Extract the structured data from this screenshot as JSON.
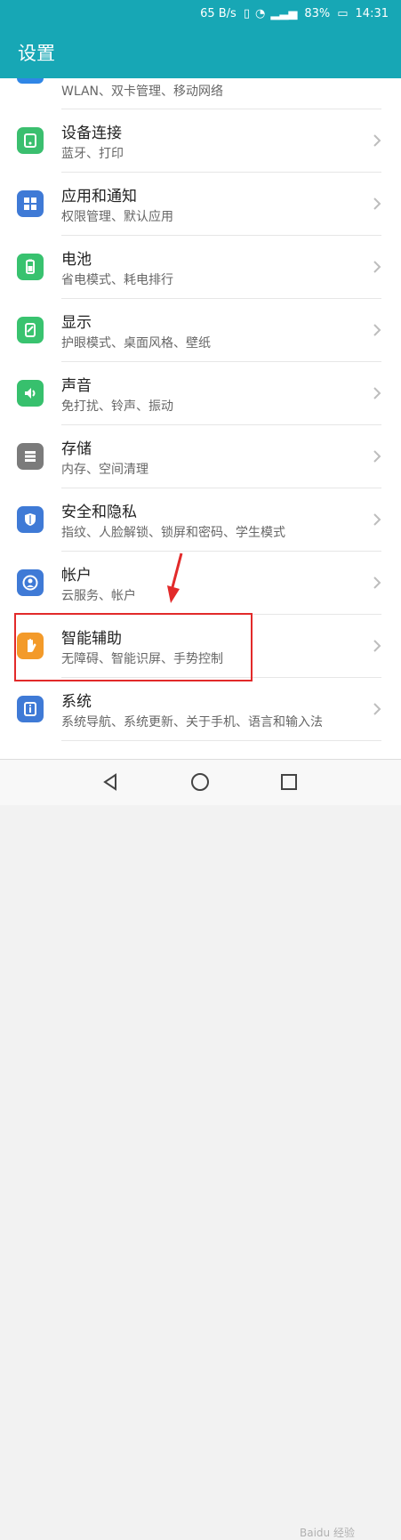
{
  "status": {
    "speed": "65 B/s",
    "battery": "83%",
    "time": "14:31"
  },
  "app": {
    "title": "设置"
  },
  "partial": {
    "subtitle": "WLAN、双卡管理、移动网络"
  },
  "items": [
    {
      "title": "设备连接",
      "subtitle": "蓝牙、打印",
      "icon": "device-connect-icon",
      "color": "#3bbf6f"
    },
    {
      "title": "应用和通知",
      "subtitle": "权限管理、默认应用",
      "icon": "apps-icon",
      "color": "#3f7ad6"
    },
    {
      "title": "电池",
      "subtitle": "省电模式、耗电排行",
      "icon": "battery-icon",
      "color": "#38c26f"
    },
    {
      "title": "显示",
      "subtitle": "护眼模式、桌面风格、壁纸",
      "icon": "display-icon",
      "color": "#39c36f"
    },
    {
      "title": "声音",
      "subtitle": "免打扰、铃声、振动",
      "icon": "speaker-icon",
      "color": "#37c06d"
    },
    {
      "title": "存储",
      "subtitle": "内存、空间清理",
      "icon": "storage-icon",
      "color": "#7b7b7b"
    },
    {
      "title": "安全和隐私",
      "subtitle": "指纹、人脸解锁、锁屏和密码、学生模式",
      "icon": "shield-icon",
      "color": "#3f7ad6"
    },
    {
      "title": "帐户",
      "subtitle": "云服务、帐户",
      "icon": "account-icon",
      "color": "#3f7ad6"
    },
    {
      "title": "智能辅助",
      "subtitle": "无障碍、智能识屏、手势控制",
      "icon": "hand-icon",
      "color": "#f39a2a"
    },
    {
      "title": "系统",
      "subtitle": "系统导航、系统更新、关于手机、语言和输入法",
      "icon": "system-info-icon",
      "color": "#3f7ad6"
    }
  ],
  "watermark": {
    "text": "Baidu 经验"
  }
}
